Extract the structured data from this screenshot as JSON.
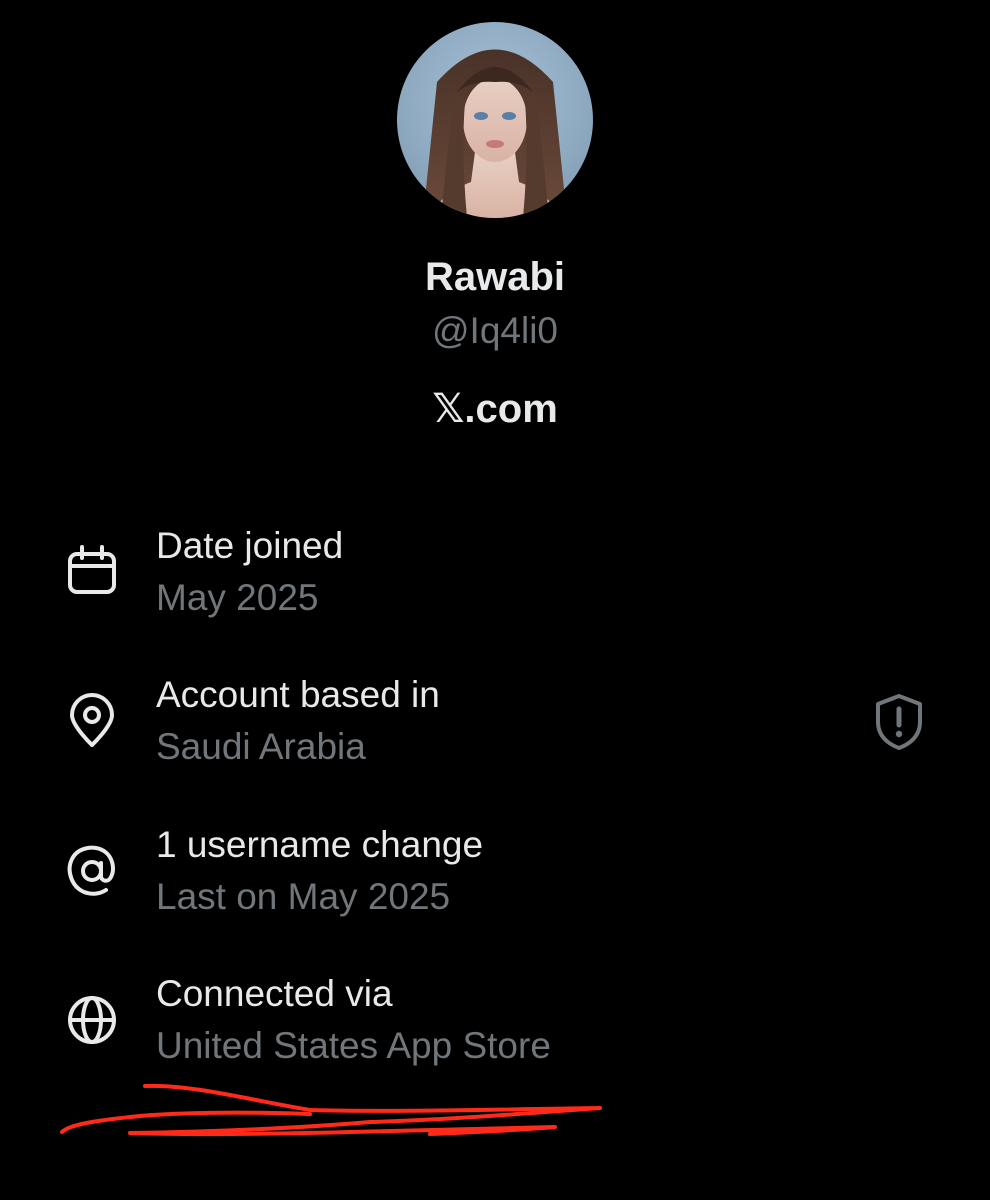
{
  "profile": {
    "name": "Rawabi",
    "handle": "@Iq4li0",
    "site": "𝕏.com"
  },
  "details": [
    {
      "icon": "calendar-icon",
      "title": "Date joined",
      "value": "May 2025"
    },
    {
      "icon": "location-pin-icon",
      "title": "Account based in",
      "value": "Saudi Arabia"
    },
    {
      "icon": "at-sign-icon",
      "title": "1 username change",
      "value": "Last on May 2025"
    },
    {
      "icon": "globe-icon",
      "title": "Connected via",
      "value": "United States App Store"
    }
  ],
  "colors": {
    "background": "#000000",
    "primary_text": "#e7e9ea",
    "secondary_text": "#71767b",
    "annotation": "#ff2a1a"
  }
}
